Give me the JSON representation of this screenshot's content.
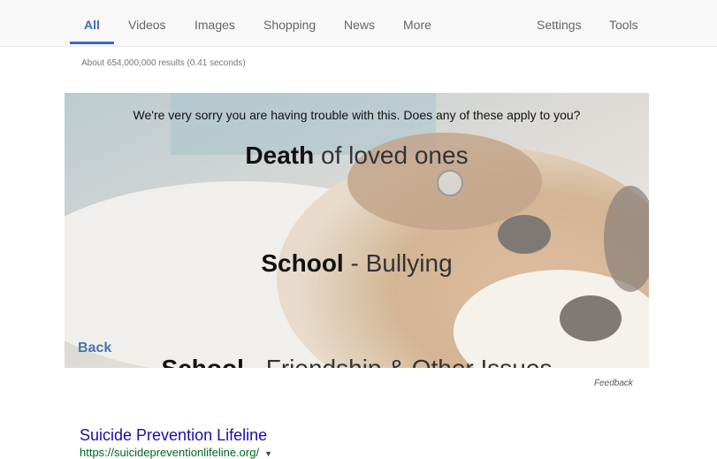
{
  "nav": {
    "tabs": [
      {
        "label": "All",
        "active": true
      },
      {
        "label": "Videos"
      },
      {
        "label": "Images"
      },
      {
        "label": "Shopping"
      },
      {
        "label": "News"
      },
      {
        "label": "More"
      }
    ],
    "right": [
      {
        "label": "Settings"
      },
      {
        "label": "Tools"
      }
    ]
  },
  "stats": "About 654,000,000 results (0.41 seconds)",
  "card": {
    "prompt": "We're very sorry you are having trouble with this. Does any of these apply to you?",
    "options": [
      {
        "bold": "Death",
        "rest": " of loved ones"
      },
      {
        "bold": "School",
        "rest": " - Bullying"
      },
      {
        "bold": "School",
        "rest": " - Friendship & Other Issues"
      }
    ],
    "back_label": "Back"
  },
  "feedback_label": "Feedback",
  "result": {
    "title": "Suicide Prevention Lifeline",
    "url": "https://suicidepreventionlifeline.org/",
    "caret": "▼"
  },
  "colors": {
    "accent": "#3f69c9",
    "link": "#1a0dab",
    "url": "#006621"
  }
}
